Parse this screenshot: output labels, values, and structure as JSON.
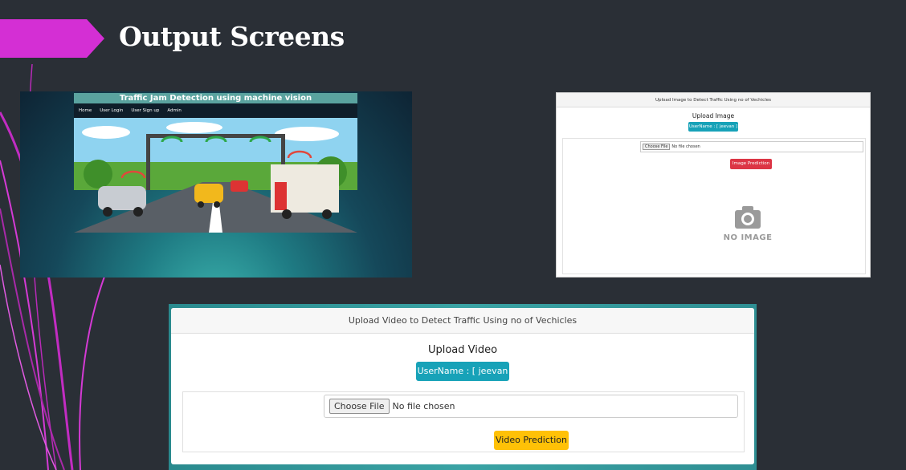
{
  "slide": {
    "title": "Output Screens",
    "accent_color": "#d42fd4",
    "background_color": "#2a2f36"
  },
  "screen_home": {
    "app_title": "Traffic Jam Detection using machine vision",
    "nav_items": [
      "Home",
      "User Login",
      "User Sign up",
      "Admin"
    ],
    "hero_icon": "traffic-highway-illustration"
  },
  "screen_image": {
    "card_header": "Upload Image to Detect Traffic Using no of Vechicles",
    "heading": "Upload Image",
    "username_label": "UserName : [ jeevan ]",
    "file_button": "Choose File",
    "file_status": "No file chosen",
    "predict_button": "Image Prediction",
    "placeholder_text": "NO IMAGE",
    "placeholder_icon": "camera-icon"
  },
  "screen_video": {
    "card_header": "Upload Video to Detect Traffic Using no of Vechicles",
    "heading": "Upload Video",
    "username_label": "UserName : [ jeevan ]",
    "file_button": "Choose File",
    "file_status": "No file chosen",
    "predict_button": "Video Prediction"
  }
}
